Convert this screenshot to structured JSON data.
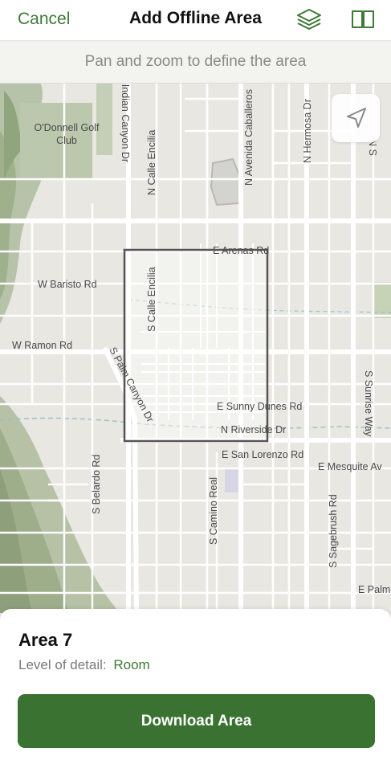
{
  "navbar": {
    "cancel_label": "Cancel",
    "title": "Add Offline Area",
    "layers_icon": "layers-icon",
    "book_icon": "book-icon"
  },
  "instruction": "Pan and zoom to define the area",
  "map": {
    "locate_icon": "navigation-arrow-icon",
    "labels": {
      "golf_line1": "O'Donnell Golf",
      "golf_line2": "Club",
      "indian_canyon": "S Indian Canyon Dr",
      "calle_encilia_n": "N Calle Encilia",
      "avenida_caballeros": "N Avenida Caballeros",
      "hermosa": "N Hermosa Dr",
      "top_right": "N S",
      "arenas": "E Arenas Rd",
      "baristo": "W Baristo Rd",
      "calle_encilia_s": "S Calle Encilia",
      "ramon": "W Ramon Rd",
      "palm_canyon": "S Palm Canyon Dr",
      "sunny_dunes": "E Sunny Dunes Rd",
      "riverside": "N Riverside Dr",
      "sunrise_way": "S Sunrise Way",
      "san_lorenzo": "E San Lorenzo Rd",
      "mesquite": "E Mesquite Av",
      "belardo": "S Belardo Rd",
      "camino_real": "S Camino Real",
      "sagebrush": "S Sagebrush Rd",
      "palm_e": "E Palm"
    }
  },
  "sheet": {
    "area_name": "Area 7",
    "lod_label": "Level of detail:",
    "lod_value": "Room",
    "download_label": "Download Area"
  },
  "colors": {
    "accent": "#3d7a35",
    "button": "#3a7331"
  }
}
